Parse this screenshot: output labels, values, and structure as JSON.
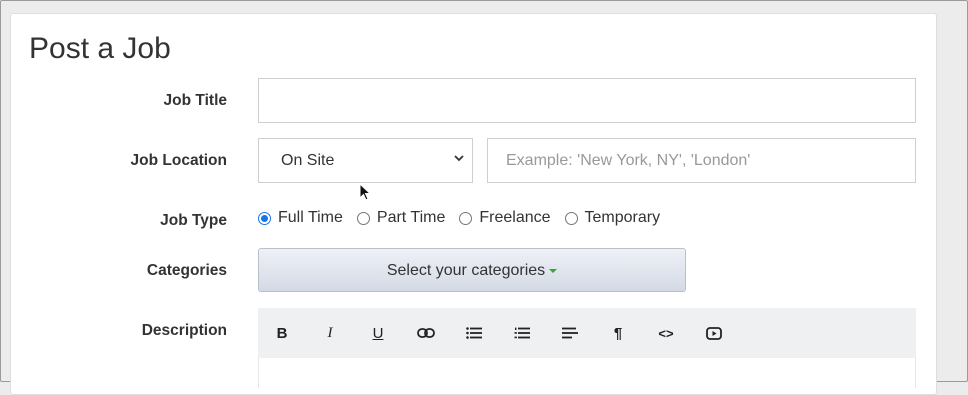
{
  "page_title": "Post a Job",
  "form": {
    "job_title": {
      "label": "Job Title",
      "value": "",
      "placeholder": ""
    },
    "job_location": {
      "label": "Job Location",
      "type_selected": "On Site",
      "location_placeholder": "Example: 'New York, NY', 'London'",
      "location_value": ""
    },
    "job_type": {
      "label": "Job Type",
      "options": [
        {
          "label": "Full Time",
          "checked": true
        },
        {
          "label": "Part Time",
          "checked": false
        },
        {
          "label": "Freelance",
          "checked": false
        },
        {
          "label": "Temporary",
          "checked": false
        }
      ]
    },
    "categories": {
      "label": "Categories",
      "button_label": "Select your categories"
    },
    "description": {
      "label": "Description",
      "toolbar": [
        {
          "name": "bold-icon",
          "glyph": "B"
        },
        {
          "name": "italic-icon",
          "glyph": "I"
        },
        {
          "name": "underline-icon",
          "glyph": "U"
        },
        {
          "name": "link-icon",
          "glyph": ""
        },
        {
          "name": "bulleted-list-icon",
          "glyph": ""
        },
        {
          "name": "numbered-list-icon",
          "glyph": ""
        },
        {
          "name": "align-left-icon",
          "glyph": ""
        },
        {
          "name": "paragraph-icon",
          "glyph": "¶"
        },
        {
          "name": "code-icon",
          "glyph": "<>"
        },
        {
          "name": "video-icon",
          "glyph": ""
        }
      ]
    }
  },
  "colors": {
    "radio_accent": "#1a73e8",
    "caret": "#33a533"
  }
}
